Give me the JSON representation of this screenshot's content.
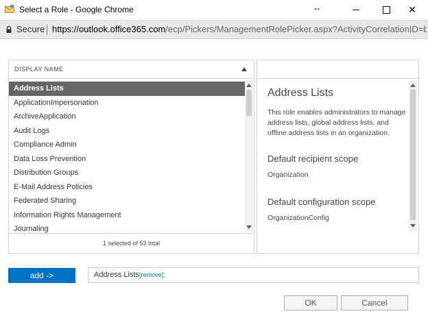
{
  "window": {
    "title": "Select a Role - Google Chrome",
    "minimize_icon": "minimize-icon",
    "maximize_icon": "maximize-icon",
    "close_glyph": "✕"
  },
  "address_bar": {
    "secure_label": "Secure",
    "url_host": "https://outlook.office365.com",
    "url_path": "/ecp/Pickers/ManagementRolePicker.aspx?ActivityCorrelationID=be..."
  },
  "list": {
    "column_header": "DISPLAY NAME",
    "items": [
      "Address Lists",
      "ApplicationImpersonation",
      "ArchiveApplication",
      "Audit Logs",
      "Compliance Admin",
      "Data Loss Prevention",
      "Distribution Groups",
      "E-Mail Address Policies",
      "Federated Sharing",
      "Information Rights Management",
      "Journaling"
    ],
    "selected_index": 0,
    "footer": "1 selected of 53 total",
    "scroll_position": 0.0
  },
  "detail": {
    "title": "Address Lists",
    "description": "This role enables administrators to manage address lists, global address lists, and offline address lists in an organization.",
    "recipient_scope_heading": "Default recipient scope",
    "recipient_scope_value": "Organization",
    "config_scope_heading": "Default configuration scope",
    "config_scope_value": "OrganizationConfig"
  },
  "add_row": {
    "add_label": "add ->",
    "selected_value": "Address Lists",
    "remove_label": "[remove]",
    "separator": ";"
  },
  "buttons": {
    "ok_label": "OK",
    "cancel_label": "Cancel"
  },
  "colors": {
    "accent": "#0072c6",
    "selected_row": "#666666"
  }
}
